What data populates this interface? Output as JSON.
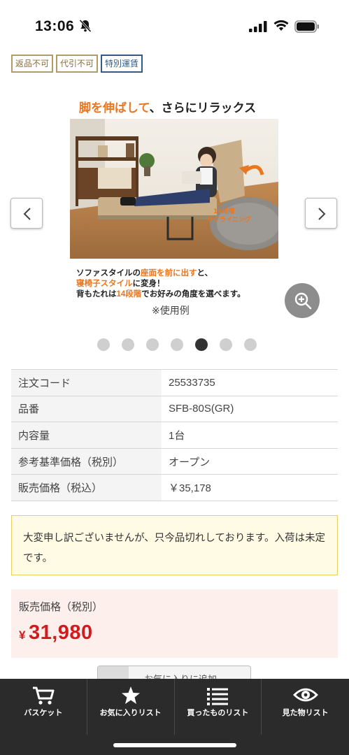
{
  "status": {
    "time": "13:06"
  },
  "tags": [
    "返品不可",
    "代引不可",
    "特別運賃"
  ],
  "gallery": {
    "headline_orange": "脚を伸ばして",
    "headline_rest": "、さらにリラックス",
    "badge_line1": "14段階",
    "badge_line2": "リクライニング",
    "caption_line1_a": "ソファスタイルの",
    "caption_line1_b": "座面を前に出す",
    "caption_line1_c": "と、",
    "caption_line2_a": "寝椅子スタイル",
    "caption_line2_b": "に変身！",
    "caption_line3_a": "背もたれは",
    "caption_line3_b": "14段階",
    "caption_line3_c": "でお好みの角度を選べます。",
    "note": "※使用例",
    "dot_count": 7,
    "active_dot": 5
  },
  "specs": [
    {
      "label": "注文コード",
      "value": "25533735"
    },
    {
      "label": "品番",
      "value": "SFB-80S(GR)"
    },
    {
      "label": "内容量",
      "value": "1台"
    },
    {
      "label": "参考基準価格（税別）",
      "value": "オープン"
    },
    {
      "label": "販売価格（税込）",
      "value": "￥35,178"
    }
  ],
  "notice": "大変申し訳ございませんが、只今品切れしております。入荷は未定です。",
  "price": {
    "label": "販売価格（税別）",
    "currency": "¥",
    "value": "31,980"
  },
  "favorite_button_label": "お気に入りに追加",
  "bottom_nav": [
    {
      "label": "バスケット",
      "icon": "cart-icon"
    },
    {
      "label": "お気に入りリスト",
      "icon": "star-icon"
    },
    {
      "label": "買ったものリスト",
      "icon": "list-icon"
    },
    {
      "label": "見た物リスト",
      "icon": "eye-icon"
    }
  ]
}
